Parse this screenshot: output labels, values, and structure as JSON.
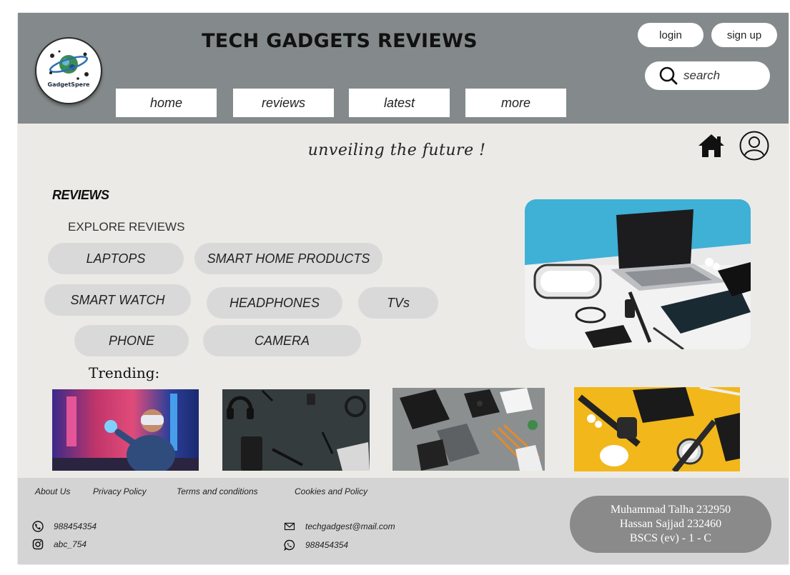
{
  "header": {
    "logo_text": "GadgetSpere",
    "title": "TECH GADGETS REVIEWS",
    "login_label": "login",
    "signup_label": "sign up",
    "search_placeholder": "search",
    "nav": [
      "home",
      "reviews",
      "latest",
      "more"
    ]
  },
  "main": {
    "tagline": "unveiling the future !",
    "reviews_heading": "REVIEWS",
    "explore_label": "EXPLORE REVIEWS",
    "categories": [
      "LAPTOPS",
      "SMART HOME PRODUCTS",
      "SMART WATCH",
      "HEADPHONES",
      "TVs",
      "PHONE",
      "CAMERA"
    ],
    "trending_label": "Trending:"
  },
  "footer": {
    "links": [
      "About Us",
      "Privacy Policy",
      "Terms and conditions",
      "Cookies and Policy"
    ],
    "phone": "988454354",
    "instagram": "abc_754",
    "email": "techgadgest@mail.com",
    "whatsapp": "988454354",
    "credits": [
      "Muhammad Talha 232950",
      "Hassan Sajjad 232460",
      "BSCS (ev) - 1 - C"
    ]
  },
  "colors": {
    "header_bg": "#848a8b",
    "page_bg": "#ebeae6",
    "pill_bg": "#d9d9d9",
    "footer_bg": "#d4d4d4",
    "credits_bg": "#8a8a8a"
  },
  "icons": [
    "logo-globe-icon",
    "search-icon",
    "home-icon",
    "user-icon",
    "phone-icon",
    "instagram-icon",
    "mail-icon",
    "whatsapp-icon"
  ]
}
